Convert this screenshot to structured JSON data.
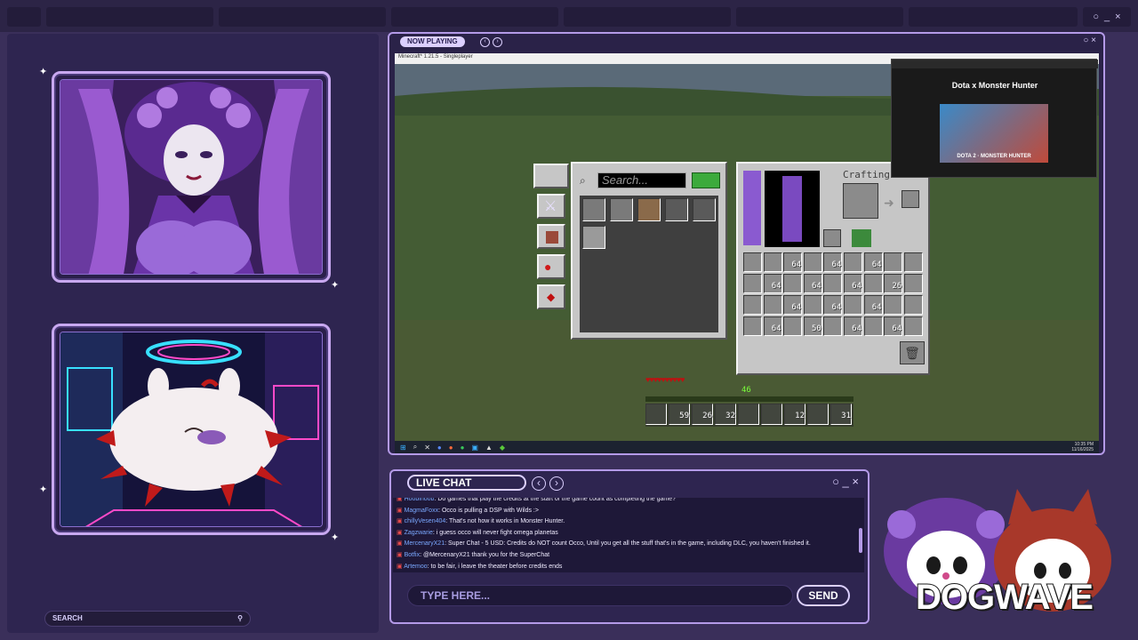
{
  "overlay": {
    "now_playing_label": "NOW PLAYING",
    "window_controls": "○ _ ×",
    "search_label": "SEARCH",
    "brand": "DOGWAVE"
  },
  "game": {
    "title_bar": "Minecraft* 1.21.5 - Singleplayer",
    "search_placeholder": "Search...",
    "crafting_label": "Crafting",
    "inventory_counts": [
      "64",
      "64",
      "64",
      "64",
      "64",
      "64",
      "26",
      "64",
      "64",
      "64",
      "64",
      "50",
      "64",
      "64",
      "64",
      "16",
      "59",
      "26",
      "32",
      "12",
      "31"
    ],
    "hotbar_counts": [
      "59",
      "26",
      "32",
      "12",
      "31"
    ],
    "xp_level": "46",
    "clock_time": "10:35 PM",
    "clock_date": "11/16/2025"
  },
  "popup": {
    "title": "Dota x Monster Hunter",
    "image_title": "DOTA 2 · MONSTER HUNTER"
  },
  "chat": {
    "title": "LIVE CHAT",
    "messages": [
      {
        "user": "Hoobinoob",
        "text": "Do games that play the credits at the start of the game count as completing the game?"
      },
      {
        "user": "MagmaFoxx",
        "text": "Occo is pulling a DSP with Wilds :>"
      },
      {
        "user": "chillyVesen404",
        "text": "That's not how it works in Monster Hunter."
      },
      {
        "user": "Zagzwarie",
        "text": "i guess occo will never fight omega planetas"
      },
      {
        "user": "MercenaryX21",
        "text": "Super Chat - 5 USD: Credits do NOT count Occo, Until you get all the stuff that's in the game, including DLC, you haven't finished it."
      },
      {
        "user": "Botfix",
        "text": "@MercenaryX21 thank you for the SuperChat"
      },
      {
        "user": "Artemoo",
        "text": "to be fair, i leave the theater before credits ends"
      }
    ],
    "input_placeholder": "TYPE HERE...",
    "send_label": "SEND"
  },
  "colors": {
    "accent": "#b49ae8",
    "background": "#3a2f5a",
    "panel": "#2e2550"
  }
}
